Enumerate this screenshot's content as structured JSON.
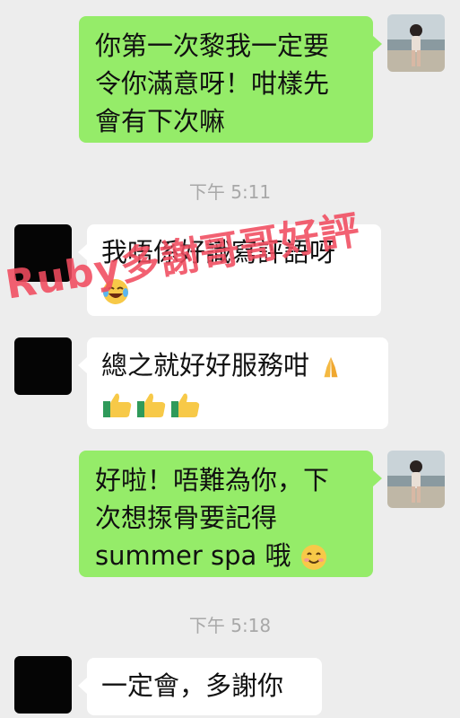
{
  "messages": [
    {
      "lines": [
        "你第一次黎我一定要",
        "令你滿意呀！咁樣先",
        "會有下次嘛"
      ]
    },
    {
      "timestamp": "下午 5:11"
    },
    {
      "lines": [
        "我唔係好識寫評語呀",
        ""
      ],
      "emoji": "laughing-crying-emoji"
    },
    {
      "lines": [
        "總之就好好服務咁"
      ],
      "emoji": "praying-hands-emoji",
      "emoji_row": [
        "thumbs-up-emoji",
        "thumbs-up-emoji",
        "thumbs-up-emoji"
      ]
    },
    {
      "lines": [
        "好啦！唔難為你，下",
        "次想揼骨要記得",
        "summer spa 哦"
      ],
      "emoji": "smiling-face-emoji"
    },
    {
      "timestamp": "下午 5:18"
    },
    {
      "lines": [
        "一定會，多謝你"
      ]
    }
  ],
  "watermark": "Ruby多謝哥哥好評",
  "colors": {
    "background": "#ededed",
    "sent_bubble": "#95ec69",
    "received_bubble": "#ffffff",
    "watermark": "#f04b5f"
  }
}
